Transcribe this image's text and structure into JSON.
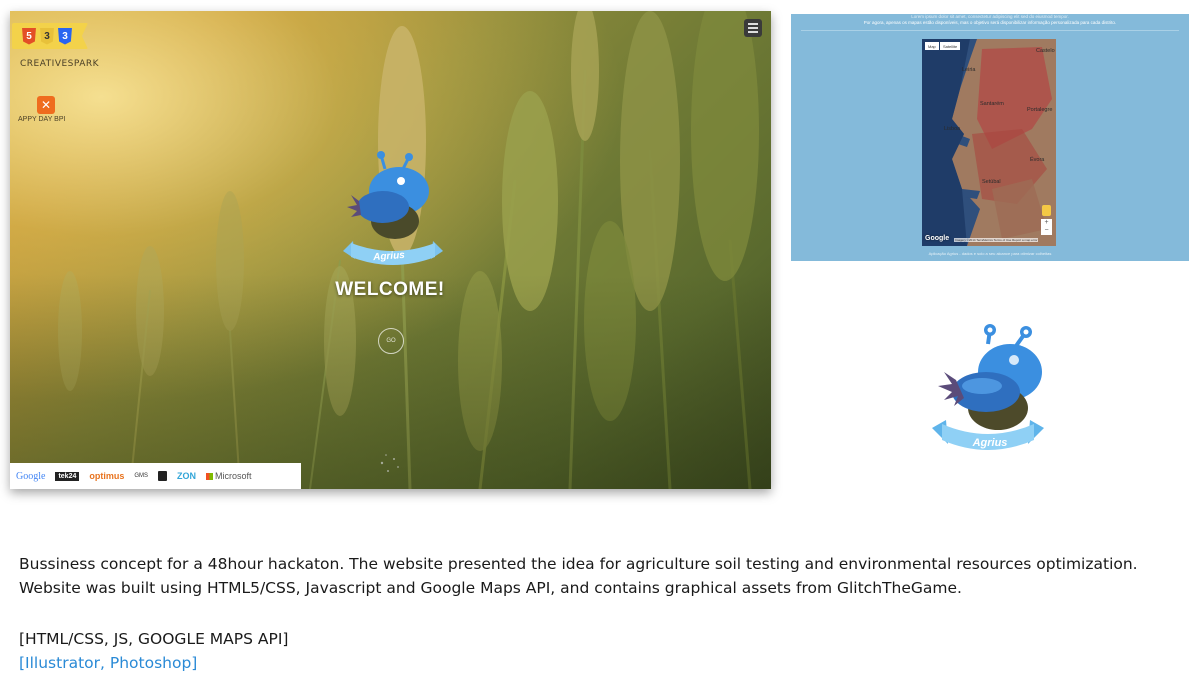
{
  "hero": {
    "badges": [
      "5",
      "3",
      "3"
    ],
    "brand": "CREATIVESPARK",
    "appy_day": "APPY DAY BPI",
    "logo_ribbon": "Agrius",
    "welcome": "WELCOME!",
    "go_button": "GO",
    "sponsors": [
      "Google",
      "tek24",
      "optimus",
      "GMS",
      "ZON",
      "Microsoft"
    ]
  },
  "map_screenshot": {
    "header_line1": "Lorem ipsum dolor sit amet, consectetur adipiscing elit sed do eiusmod tempor.",
    "header_line2": "Por agora, apenas os mapas estão disponíveis, mas o objetivo será disponibilizar informação personalizada para cada distrito.",
    "map_type_buttons": [
      "Map",
      "Satellite"
    ],
    "cities": [
      "Leiria",
      "Castelo",
      "Santarém",
      "Portalegre",
      "Lisboa",
      "Évora",
      "Setúbal"
    ],
    "google_mark": "Google",
    "copyright": "Imagery ©2014 TerraMetrics  Terms of Use  Report a map error",
    "zoom_in": "+",
    "zoom_out": "−",
    "footer_note": "Aplicação Agrius - dados e solo a seu alcance para otimizar colheitas"
  },
  "logo_ribbon": "Agrius",
  "description": {
    "line1": "Bussiness concept for a 48hour hackaton. The website presented the idea for agriculture soil testing and environmental resources optimization.",
    "line2": "Website was built using HTML5/CSS, Javascript and Google Maps API, and contains graphical assets from GlitchTheGame.",
    "tech": "[HTML/CSS, JS, GOOGLE MAPS API]",
    "tools": "[Illustrator, Photoshop]"
  },
  "colors": {
    "accent_blue": "#2a8ad6",
    "map_background": "#84bada",
    "badge_yellow": "#f3d24a",
    "mascot_blue": "#3b8fe0"
  }
}
